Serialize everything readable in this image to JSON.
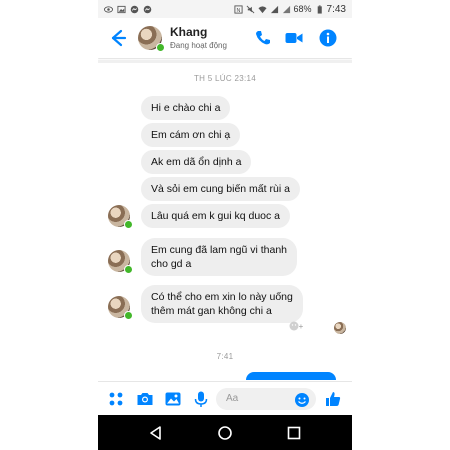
{
  "status_bar": {
    "battery": "68%",
    "time": "7:43"
  },
  "header": {
    "name": "Khang",
    "status": "Đang hoạt động"
  },
  "timestamps": {
    "first": "TH 5 LÚC 23:14",
    "second": "7:41"
  },
  "messages": [
    {
      "text": "Hi e chào chi a"
    },
    {
      "text": "Em cám ơn chi ạ"
    },
    {
      "text": "Ak em dã ổn dịnh a"
    },
    {
      "text": "Và sỏi em cung biến mất rùi a"
    },
    {
      "text": "Lâu quá em k gui kq duoc a"
    },
    {
      "text": "Em cung đã lam ngũ vi thanh\ncho gd a"
    },
    {
      "text": "Có thể cho em xin lo này uống\nthêm mát gan không chi a"
    }
  ],
  "composer": {
    "placeholder": "Aa"
  },
  "colors": {
    "accent": "#0084ff",
    "bubble": "#eeeeee",
    "online": "#42b72a"
  }
}
